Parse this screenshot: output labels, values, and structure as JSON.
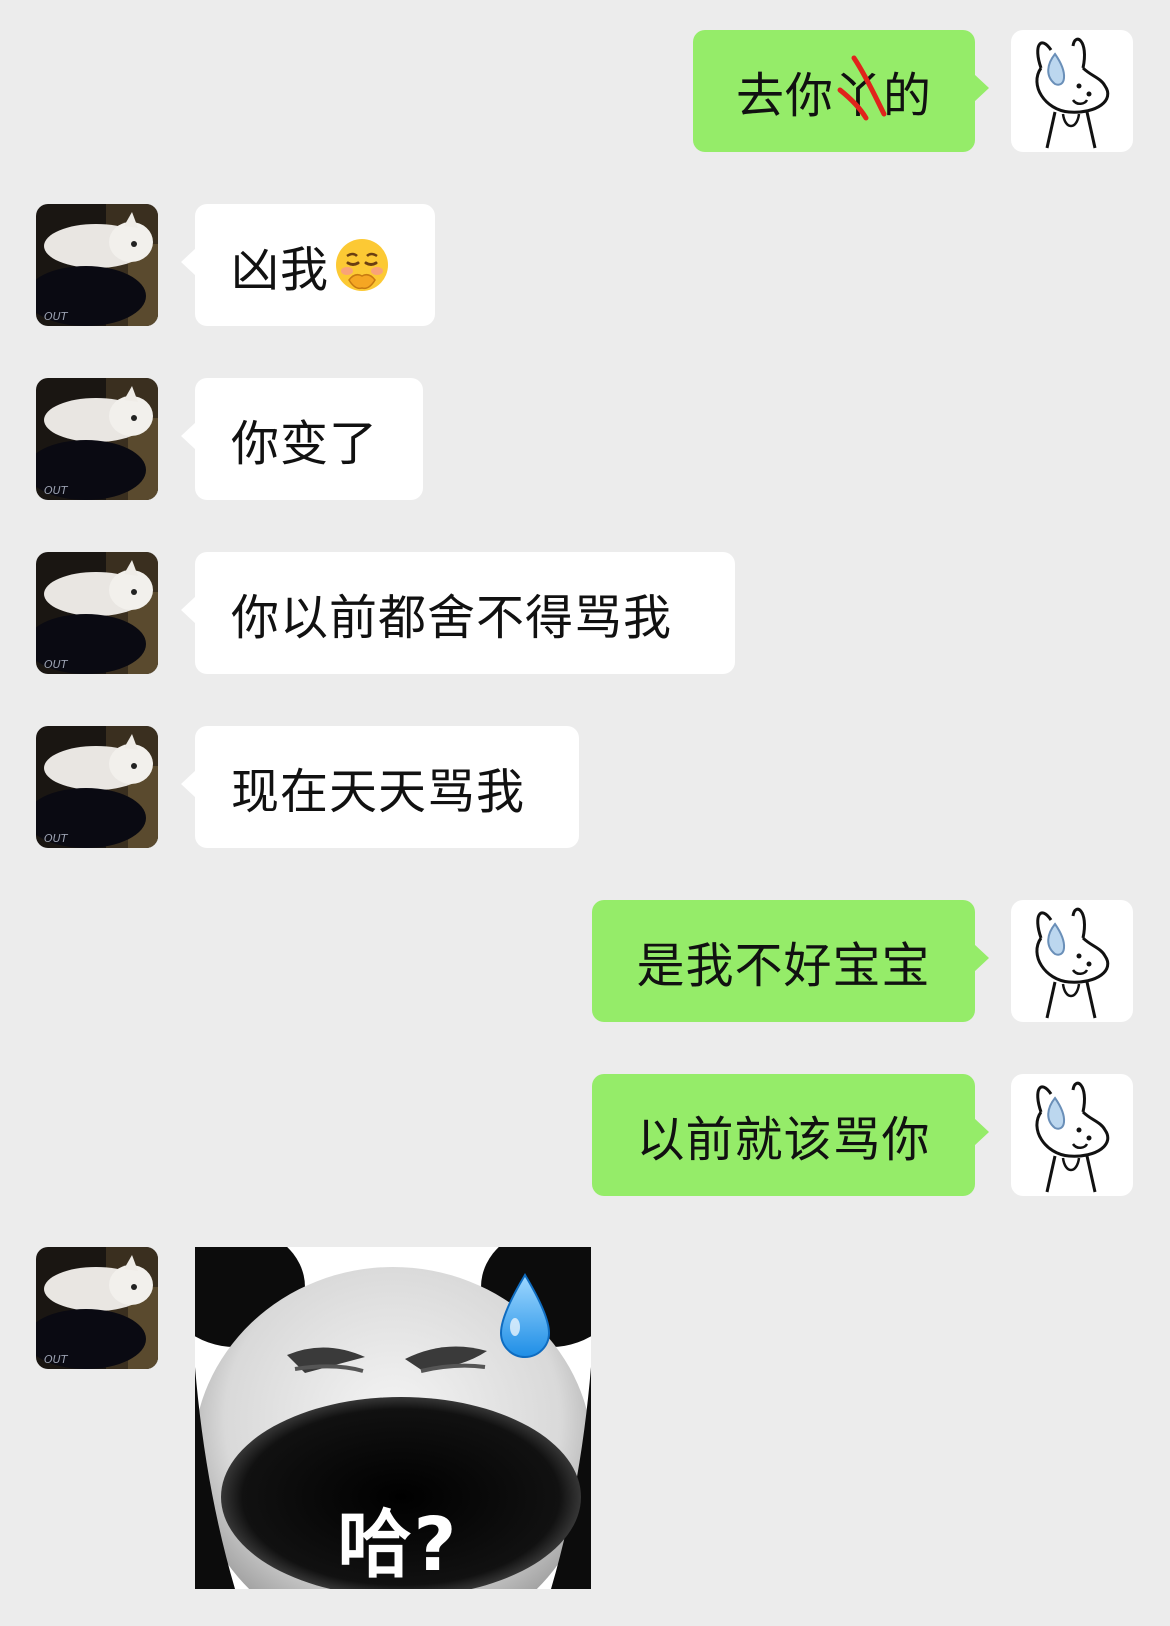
{
  "messages": [
    {
      "side": "out",
      "text_before": "去你",
      "struck_char": "丫",
      "text_after": "的"
    },
    {
      "side": "in",
      "text": "凶我",
      "emoji": "pouting-hand-over-mouth-emoji"
    },
    {
      "side": "in",
      "text": "你变了"
    },
    {
      "side": "in",
      "text": "你以前都舍不得骂我"
    },
    {
      "side": "in",
      "text": "现在天天骂我"
    },
    {
      "side": "out",
      "text": "是我不好宝宝"
    },
    {
      "side": "out",
      "text": "以前就该骂你"
    },
    {
      "side": "in",
      "sticker": "panda-face-sweat-sticker",
      "sticker_caption": "哈?"
    }
  ],
  "colors": {
    "background": "#ececec",
    "incoming_bubble": "#ffffff",
    "outgoing_bubble": "#95ec69"
  },
  "avatars": {
    "self": "bunny-avatar",
    "other": "cat-avatar"
  }
}
